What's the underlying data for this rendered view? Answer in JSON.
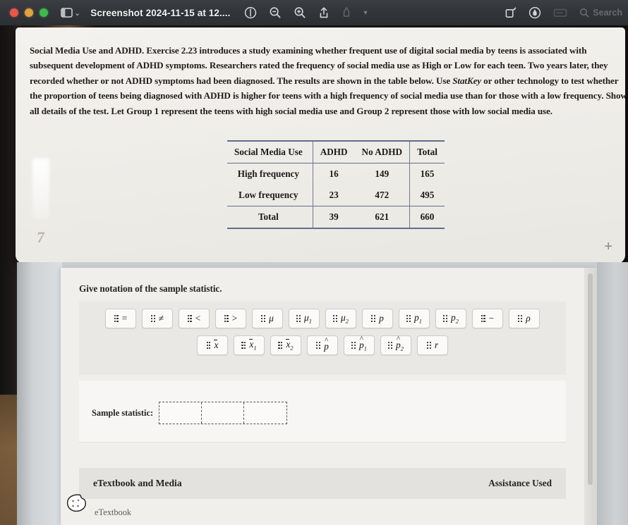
{
  "window": {
    "title": "Screenshot 2024-11-15 at 12....",
    "traffic_lights": [
      "close-red",
      "minimize-yellow",
      "zoom-green"
    ],
    "toolbar_icons": [
      "sidebar-toggle-icon",
      "chevron-down-icon",
      "markup-info-icon",
      "zoom-out-icon",
      "zoom-in-icon",
      "share-icon",
      "highlight-pen-icon",
      "pen-chevron-icon",
      "rotate-icon",
      "annotate-icon",
      "crop-icon"
    ],
    "search_placeholder": "Search",
    "colors": {
      "titlebar": "#32363a",
      "red": "#e8564a",
      "yellow": "#e3a23c",
      "green": "#3fb94f"
    }
  },
  "problem": {
    "title": "Social Media Use and ADHD.",
    "body_part1": " Exercise 2.23 introduces a study examining whether frequent use of digital social media by teens is associated with subsequent development of ADHD symptoms. Researchers rated the frequency of social media use as High or Low for each teen. Two years later, they recorded whether or not ADHD symptoms had been diagnosed. The results are shown in the table below. Use ",
    "statkey": "StatKey",
    "body_part2": " or other technology to test whether the proportion of teens being diagnosed with ADHD is higher for teens with a high frequency of social media use than for those with a low frequency. Show all details of the test. Let Group 1 represent the teens with high social media use and Group 2 represent those with low social media use.",
    "page_marker": "7",
    "plus_marker": "+"
  },
  "table": {
    "headers": [
      "Social Media Use",
      "ADHD",
      "No ADHD",
      "Total"
    ],
    "rows": [
      {
        "label": "High frequency",
        "adhd": "16",
        "no_adhd": "149",
        "total": "165"
      },
      {
        "label": "Low frequency",
        "adhd": "23",
        "no_adhd": "472",
        "total": "495"
      }
    ],
    "footer": {
      "label": "Total",
      "adhd": "39",
      "no_adhd": "621",
      "total": "660"
    }
  },
  "task": {
    "prompt": "Give notation of the sample statistic."
  },
  "palette": {
    "row1": [
      {
        "name": "equals",
        "sym": "=",
        "sub": "",
        "style": "op",
        "deco": "none"
      },
      {
        "name": "not-equal",
        "sym": "≠",
        "sub": "",
        "style": "op",
        "deco": "none"
      },
      {
        "name": "less-than",
        "sym": "<",
        "sub": "",
        "style": "op",
        "deco": "none"
      },
      {
        "name": "greater-than",
        "sym": ">",
        "sub": "",
        "style": "op",
        "deco": "none"
      },
      {
        "name": "mu",
        "sym": "μ",
        "sub": "",
        "style": "var",
        "deco": "none"
      },
      {
        "name": "mu-1",
        "sym": "μ",
        "sub": "1",
        "style": "var",
        "deco": "none"
      },
      {
        "name": "mu-2",
        "sym": "μ",
        "sub": "2",
        "style": "var",
        "deco": "none"
      },
      {
        "name": "p",
        "sym": "p",
        "sub": "",
        "style": "var",
        "deco": "none"
      },
      {
        "name": "p-1",
        "sym": "p",
        "sub": "1",
        "style": "var",
        "deco": "none"
      },
      {
        "name": "p-2",
        "sym": "p",
        "sub": "2",
        "style": "var",
        "deco": "none"
      },
      {
        "name": "minus",
        "sym": "−",
        "sub": "",
        "style": "op",
        "deco": "none"
      },
      {
        "name": "rho",
        "sym": "ρ",
        "sub": "",
        "style": "var",
        "deco": "none"
      }
    ],
    "row2": [
      {
        "name": "x-bar",
        "sym": "x",
        "sub": "",
        "style": "var",
        "deco": "bar"
      },
      {
        "name": "x-bar-1",
        "sym": "x",
        "sub": "1",
        "style": "var",
        "deco": "bar"
      },
      {
        "name": "x-bar-2",
        "sym": "x",
        "sub": "2",
        "style": "var",
        "deco": "bar"
      },
      {
        "name": "p-hat",
        "sym": "p",
        "sub": "",
        "style": "var",
        "deco": "hat"
      },
      {
        "name": "p-hat-1",
        "sym": "p",
        "sub": "1",
        "style": "var",
        "deco": "hat"
      },
      {
        "name": "p-hat-2",
        "sym": "p",
        "sub": "2",
        "style": "var",
        "deco": "hat"
      },
      {
        "name": "r",
        "sym": "r",
        "sub": "",
        "style": "var",
        "deco": "none"
      }
    ]
  },
  "answer": {
    "label": "Sample statistic:",
    "boxes": [
      "",
      "",
      ""
    ]
  },
  "footer": {
    "left_label": "eTextbook and Media",
    "right_label": "Assistance Used",
    "etextbook_link": "eTextbook",
    "cookie_icon": "cookie-consent-icon"
  }
}
